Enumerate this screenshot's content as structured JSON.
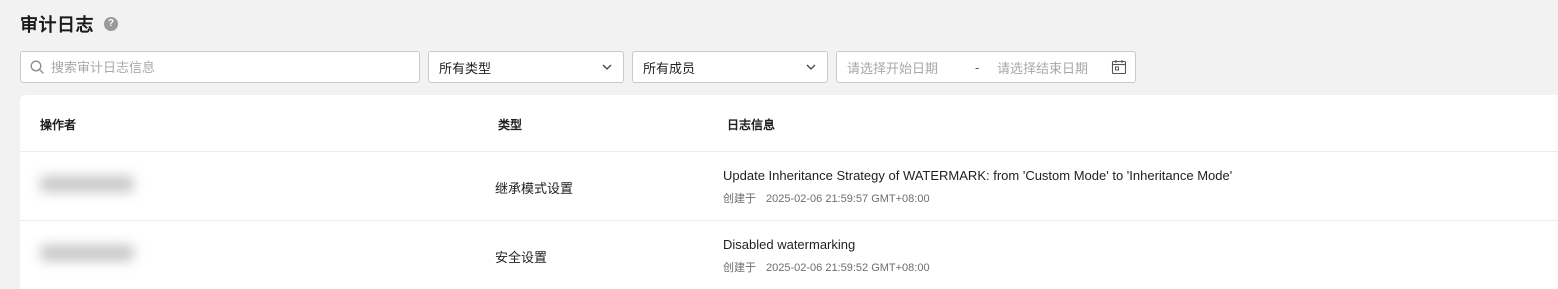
{
  "page": {
    "title": "审计日志",
    "help_icon": "question-circle-icon"
  },
  "filters": {
    "search_placeholder": "搜索审计日志信息",
    "search_icon": "search-icon",
    "type_select": {
      "selected": "所有类型"
    },
    "member_select": {
      "selected": "所有成员"
    },
    "date_range": {
      "start_placeholder": "请选择开始日期",
      "separator": "-",
      "end_placeholder": "请选择结束日期",
      "icon": "calendar-icon"
    }
  },
  "table": {
    "columns": [
      "操作者",
      "类型",
      "日志信息"
    ],
    "rows": [
      {
        "operator": "",
        "type": "继承模式设置",
        "message": "Update Inheritance Strategy of WATERMARK: from 'Custom Mode' to 'Inheritance Mode'",
        "created_label": "创建于",
        "created_at": "2025-02-06 21:59:57 GMT+08:00"
      },
      {
        "operator": "",
        "type": "安全设置",
        "message": "Disabled watermarking",
        "created_label": "创建于",
        "created_at": "2025-02-06 21:59:52 GMT+08:00"
      }
    ]
  }
}
